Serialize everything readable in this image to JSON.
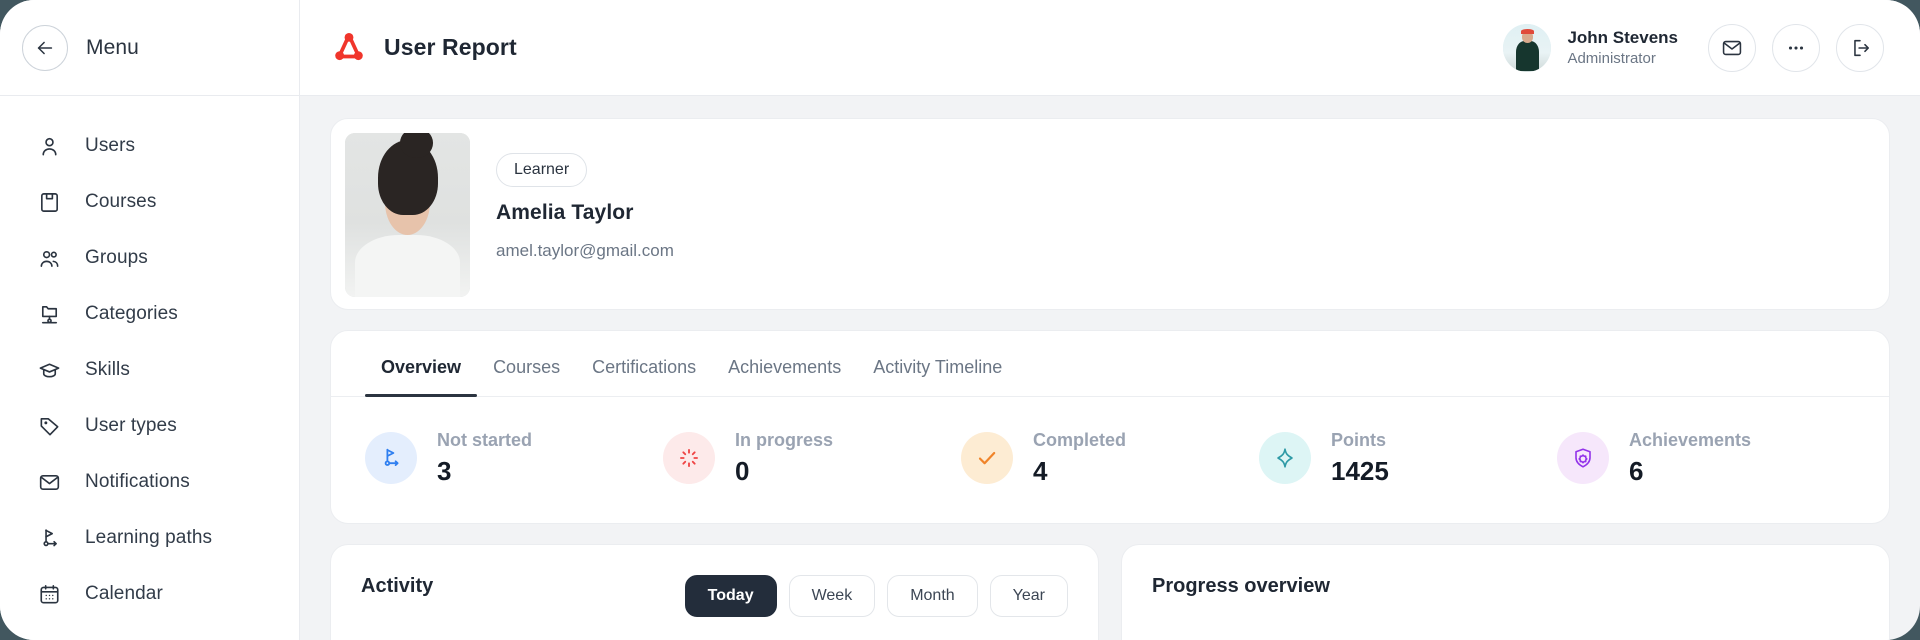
{
  "sidebar": {
    "back_icon": "arrow-left-icon",
    "menu_label": "Menu",
    "items": [
      {
        "label": "Users",
        "icon": "user-icon"
      },
      {
        "label": "Courses",
        "icon": "book-icon"
      },
      {
        "label": "Groups",
        "icon": "users-group-icon"
      },
      {
        "label": "Categories",
        "icon": "folder-tree-icon"
      },
      {
        "label": "Skills",
        "icon": "graduation-cap-icon"
      },
      {
        "label": "User types",
        "icon": "tag-icon"
      },
      {
        "label": "Notifications",
        "icon": "envelope-icon"
      },
      {
        "label": "Learning paths",
        "icon": "flag-path-icon"
      },
      {
        "label": "Calendar",
        "icon": "calendar-icon"
      }
    ]
  },
  "header": {
    "logo_icon": "triskelion-logo-icon",
    "title": "User Report",
    "user": {
      "name": "John Stevens",
      "role": "Administrator",
      "avatar": "user-avatar"
    },
    "actions": [
      {
        "name": "mail-icon",
        "label": "Messages"
      },
      {
        "name": "ellipsis-icon",
        "label": "More options"
      },
      {
        "name": "logout-icon",
        "label": "Log out"
      }
    ]
  },
  "profile": {
    "photo": "learner-photo",
    "badge": "Learner",
    "name": "Amelia Taylor",
    "email": "amel.taylor@gmail.com"
  },
  "tabs": [
    {
      "label": "Overview",
      "active": true
    },
    {
      "label": "Courses",
      "active": false
    },
    {
      "label": "Certifications",
      "active": false
    },
    {
      "label": "Achievements",
      "active": false
    },
    {
      "label": "Activity Timeline",
      "active": false
    }
  ],
  "stats": [
    {
      "label": "Not started",
      "value": "3",
      "icon": "flag-path-icon",
      "color": "#2f7ff0",
      "bg": "#e4eefd"
    },
    {
      "label": "In progress",
      "value": "0",
      "icon": "spinner-icon",
      "color": "#ef4444",
      "bg": "#fdeaea"
    },
    {
      "label": "Completed",
      "value": "4",
      "icon": "check-icon",
      "color": "#f0842a",
      "bg": "#fdecd3"
    },
    {
      "label": "Points",
      "value": "1425",
      "icon": "sparkle-icon",
      "color": "#2e9aa6",
      "bg": "#ddf5f5"
    },
    {
      "label": "Achievements",
      "value": "6",
      "icon": "badge-icon",
      "color": "#9333ea",
      "bg": "#f6e7fb"
    }
  ],
  "activity": {
    "title": "Activity",
    "ranges": [
      {
        "label": "Today",
        "active": true
      },
      {
        "label": "Week",
        "active": false
      },
      {
        "label": "Month",
        "active": false
      },
      {
        "label": "Year",
        "active": false
      }
    ]
  },
  "progress": {
    "title": "Progress overview"
  },
  "theme": {
    "accent_red": "#f0352b",
    "page_bg": "#f2f3f5",
    "outer_bg": "#42575f",
    "text_dark": "#1f2733",
    "text_muted": "#6b7685"
  }
}
